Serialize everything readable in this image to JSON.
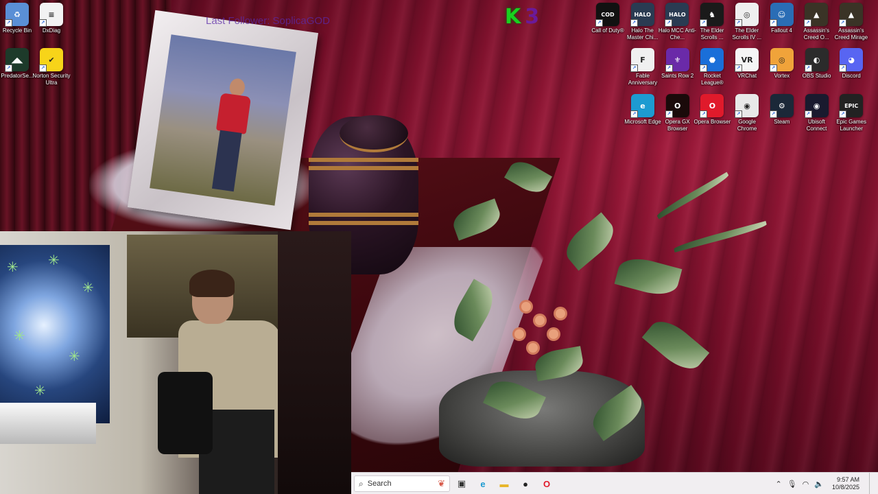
{
  "watermark": {
    "text": "Last Follower: SoplicaGOD"
  },
  "k3_logo": {
    "k": "K",
    "n": "3"
  },
  "desktop_icons_left": [
    {
      "id": "recycle-bin",
      "label": "Recycle Bin",
      "icon": "recycle-bin-icon",
      "color": "#5a8fd6",
      "glyph": "♻"
    },
    {
      "id": "dxdiag",
      "label": "DxDiag",
      "icon": "document-icon",
      "color": "#f2f2f2",
      "glyph": "≡"
    },
    {
      "id": "predatorsense",
      "label": "PredatorSe...",
      "icon": "predator-icon",
      "color": "#1d3a2a",
      "glyph": "◢◣"
    },
    {
      "id": "norton",
      "label": "Norton Security Ultra",
      "icon": "norton-icon",
      "color": "#f7d419",
      "glyph": "✔"
    }
  ],
  "desktop_icons_right": [
    {
      "id": "cod",
      "label": "Call of Duty®",
      "icon": "call-of-duty-icon",
      "color": "#111111",
      "glyph": "COD"
    },
    {
      "id": "halo-mcc-chief",
      "label": "Halo The Master Chi...",
      "icon": "halo-icon",
      "color": "#2a3b52",
      "glyph": "HALO"
    },
    {
      "id": "halo-mcc-anticheat",
      "label": "Halo MCC Anti-Che...",
      "icon": "halo-icon",
      "color": "#2a3b52",
      "glyph": "HALO"
    },
    {
      "id": "elder-scrolls-online",
      "label": "The Elder Scrolls ...",
      "icon": "elder-scrolls-icon",
      "color": "#1a1a1a",
      "glyph": "♞"
    },
    {
      "id": "oblivion",
      "label": "The Elder Scrolls IV ...",
      "icon": "oblivion-icon",
      "color": "#efefef",
      "glyph": "◎"
    },
    {
      "id": "fallout4",
      "label": "Fallout 4",
      "icon": "fallout-icon",
      "color": "#2a6db5",
      "glyph": "☺"
    },
    {
      "id": "ac-odyssey",
      "label": "Assassin's Creed O...",
      "icon": "assassins-creed-icon",
      "color": "#3a3326",
      "glyph": "▲"
    },
    {
      "id": "ac-mirage",
      "label": "Assassin's Creed Mirage",
      "icon": "assassins-creed-icon",
      "color": "#3a3326",
      "glyph": "▲"
    },
    {
      "id": "fable",
      "label": "Fable Anniversary",
      "icon": "fable-icon",
      "color": "#f0f0f0",
      "glyph": "F"
    },
    {
      "id": "saints-row",
      "label": "Saints Row 2",
      "icon": "saints-row-icon",
      "color": "#6a2aa8",
      "glyph": "⚜"
    },
    {
      "id": "rocket-league",
      "label": "Rocket League®",
      "icon": "rocket-league-icon",
      "color": "#1a6fd9",
      "glyph": "⬣"
    },
    {
      "id": "vrchat",
      "label": "VRChat",
      "icon": "vrchat-icon",
      "color": "#f5f5f5",
      "glyph": "VR"
    },
    {
      "id": "vortex",
      "label": "Vortex",
      "icon": "vortex-icon",
      "color": "#f0a33a",
      "glyph": "◎"
    },
    {
      "id": "obs",
      "label": "OBS Studio",
      "icon": "obs-icon",
      "color": "#2b2b2b",
      "glyph": "◐"
    },
    {
      "id": "discord",
      "label": "Discord",
      "icon": "discord-icon",
      "color": "#5865f2",
      "glyph": "◕"
    },
    {
      "id": "edge",
      "label": "Microsoft Edge",
      "icon": "edge-icon",
      "color": "#1d9bd1",
      "glyph": "e"
    },
    {
      "id": "opera-gx",
      "label": "Opera GX Browser",
      "icon": "opera-gx-icon",
      "color": "#1a0a0a",
      "glyph": "O"
    },
    {
      "id": "opera",
      "label": "Opera Browser",
      "icon": "opera-icon",
      "color": "#e01a2b",
      "glyph": "O"
    },
    {
      "id": "chrome",
      "label": "Google Chrome",
      "icon": "chrome-icon",
      "color": "#e8e8e8",
      "glyph": "◉"
    },
    {
      "id": "steam",
      "label": "Steam",
      "icon": "steam-icon",
      "color": "#1b2838",
      "glyph": "⚙"
    },
    {
      "id": "ubisoft",
      "label": "Ubisoft Connect",
      "icon": "ubisoft-icon",
      "color": "#1a1a2e",
      "glyph": "◉"
    },
    {
      "id": "epic",
      "label": "Epic Games Launcher",
      "icon": "epic-games-icon",
      "color": "#222222",
      "glyph": "EPIC"
    }
  ],
  "taskbar": {
    "search_placeholder": "Search",
    "apps": [
      {
        "id": "task-view",
        "icon": "task-view-icon",
        "glyph": "▣",
        "color": "#333333"
      },
      {
        "id": "edge",
        "icon": "edge-icon",
        "glyph": "e",
        "color": "#1d9bd1"
      },
      {
        "id": "file-explorer",
        "icon": "folder-icon",
        "glyph": "▬",
        "color": "#e8b52a"
      },
      {
        "id": "app-red",
        "icon": "app-icon",
        "glyph": "●",
        "color": "#222222"
      },
      {
        "id": "opera",
        "icon": "opera-icon",
        "glyph": "O",
        "color": "#e01a2b"
      }
    ],
    "tray": {
      "time": "9:57 AM",
      "date": "10/8/2025"
    }
  }
}
